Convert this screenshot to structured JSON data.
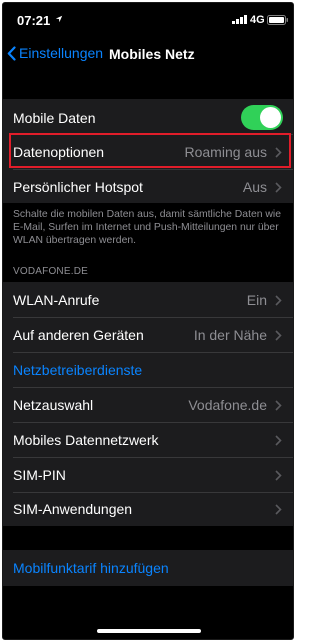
{
  "status_bar": {
    "time": "07:21",
    "network": "4G"
  },
  "nav": {
    "back_label": "Einstellungen",
    "title": "Mobiles Netz"
  },
  "group1": {
    "mobile_data": {
      "label": "Mobile Daten",
      "on": true
    },
    "data_options": {
      "label": "Datenoptionen",
      "value": "Roaming aus"
    },
    "hotspot": {
      "label": "Persönlicher Hotspot",
      "value": "Aus"
    }
  },
  "footer_text": "Schalte die mobilen Daten aus, damit sämtliche Daten wie E-Mail, Surfen im Internet und Push-Mitteilungen nur über WLAN übertragen werden.",
  "section_header": "VODAFONE.DE",
  "group2": {
    "wifi_calls": {
      "label": "WLAN-Anrufe",
      "value": "Ein"
    },
    "other_devices": {
      "label": "Auf anderen Geräten",
      "value": "In der Nähe"
    },
    "carrier_services": {
      "label": "Netzbetreiberdienste"
    },
    "network_selection": {
      "label": "Netzauswahl",
      "value": "Vodafone.de"
    },
    "mobile_data_network": {
      "label": "Mobiles Datennetzwerk"
    },
    "sim_pin": {
      "label": "SIM-PIN"
    },
    "sim_apps": {
      "label": "SIM-Anwendungen"
    }
  },
  "add_plan": {
    "label": "Mobilfunktarif hinzufügen"
  },
  "colors": {
    "accent": "#0a84ff",
    "toggle_on": "#30d158",
    "highlight": "#e11d2a"
  }
}
